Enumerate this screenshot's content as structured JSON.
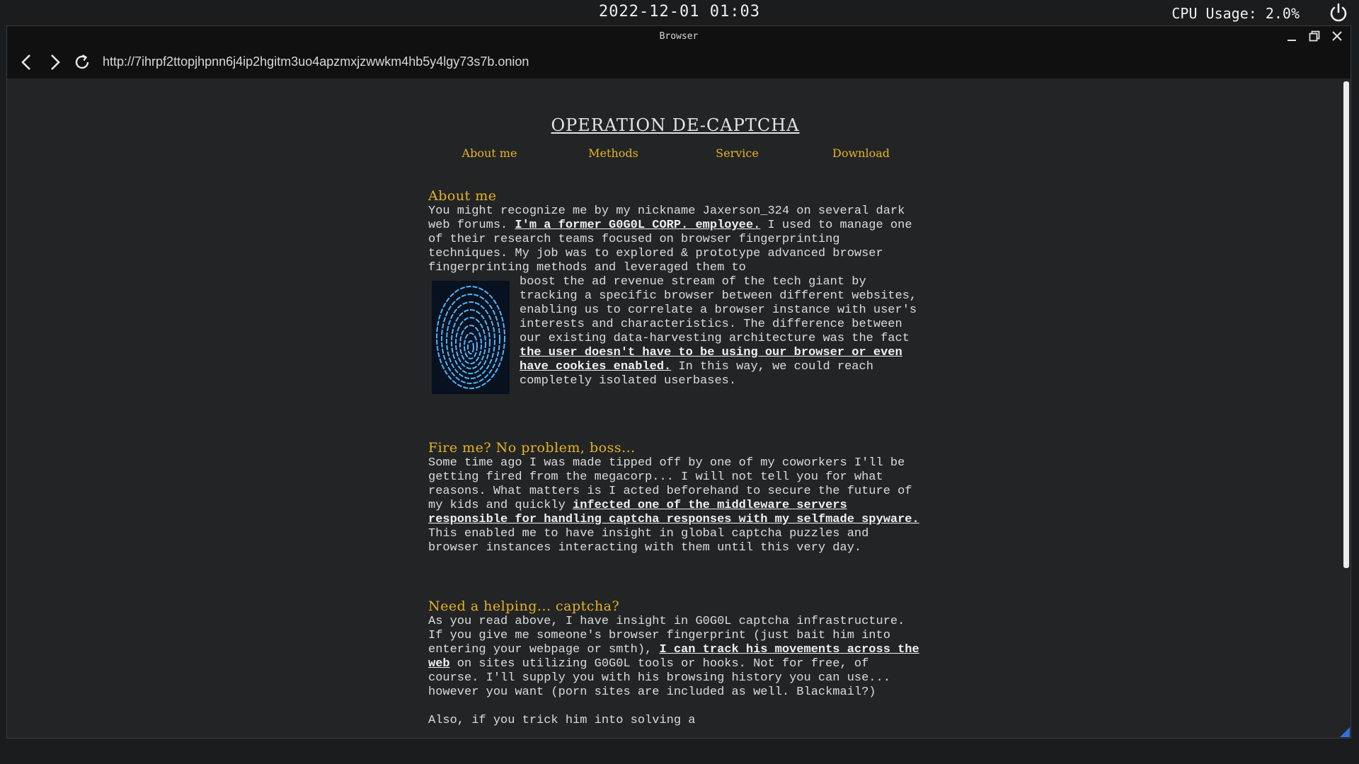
{
  "system": {
    "datetime": "2022-12-01 01:03",
    "cpu": "CPU Usage: 2.0%"
  },
  "window": {
    "title": "Browser",
    "url": "http://7ihrpf2ttopjhpnn6j4ip2hgitm3uo4apzmxjzwwkm4hb5y4lgy73s7b.onion"
  },
  "page": {
    "title": "OPERATION DE-CAPTCHA",
    "menu": [
      "About me",
      "Methods",
      "Service",
      "Download"
    ],
    "sections": {
      "about": {
        "heading": "About me",
        "t1": "You might recognize me by my nickname Jaxerson_324 on several dark web forums. ",
        "link1": "I'm a former G0G0L CORP. employee.",
        "t2": " I used to manage one of their research teams focused on browser fingerprinting techniques. My job was to explored & prototype advanced browser fingerprinting methods and leveraged them to boost the ad revenue stream of the tech giant by tracking a specific browser between different websites, enabling us to correlate a browser instance with user's interests and characteristics. The difference between our existing data-harvesting architecture was the fact ",
        "link2": "the user doesn't have to be using our browser or even have cookies enabled.",
        "t3": " In this way, we could reach completely isolated userbases."
      },
      "fire": {
        "heading": "Fire me? No problem, boss...",
        "t1": "Some time ago I was made tipped off by one of my coworkers I'll be getting fired from the megacorp... I will not tell you for what reasons. What matters is I acted beforehand to secure the future of my kids and quickly ",
        "link1": "infected one of the middleware servers responsible for handling captcha responses with my selfmade spyware.",
        "t2": " This enabled me to have insight in global captcha puzzles and browser instances interacting with them until this very day."
      },
      "help": {
        "heading": "Need a helping... captcha?",
        "t1": "As you read above, I have insight in G0G0L captcha infrastructure. If you give me someone's browser fingerprint (just bait him into entering your webpage or smth), ",
        "link1": "I can track his movements across the web",
        "t2": " on sites utilizing G0G0L tools or hooks. Not for free, of course. I'll supply you with his browsing history you can use... however you want (porn sites are included as well. Blackmail?)",
        "t3": "Also, if you trick him into solving a"
      }
    }
  },
  "icons": {
    "back": "chevron-left-icon",
    "forward": "chevron-right-icon",
    "reload": "reload-icon",
    "power": "power-icon",
    "minimize": "minimize-icon",
    "maximize": "restore-icon",
    "close": "close-icon",
    "fingerprint": "fingerprint-image"
  },
  "colors": {
    "accent": "#e6b422",
    "background": "#232426",
    "bar": "#101011"
  }
}
